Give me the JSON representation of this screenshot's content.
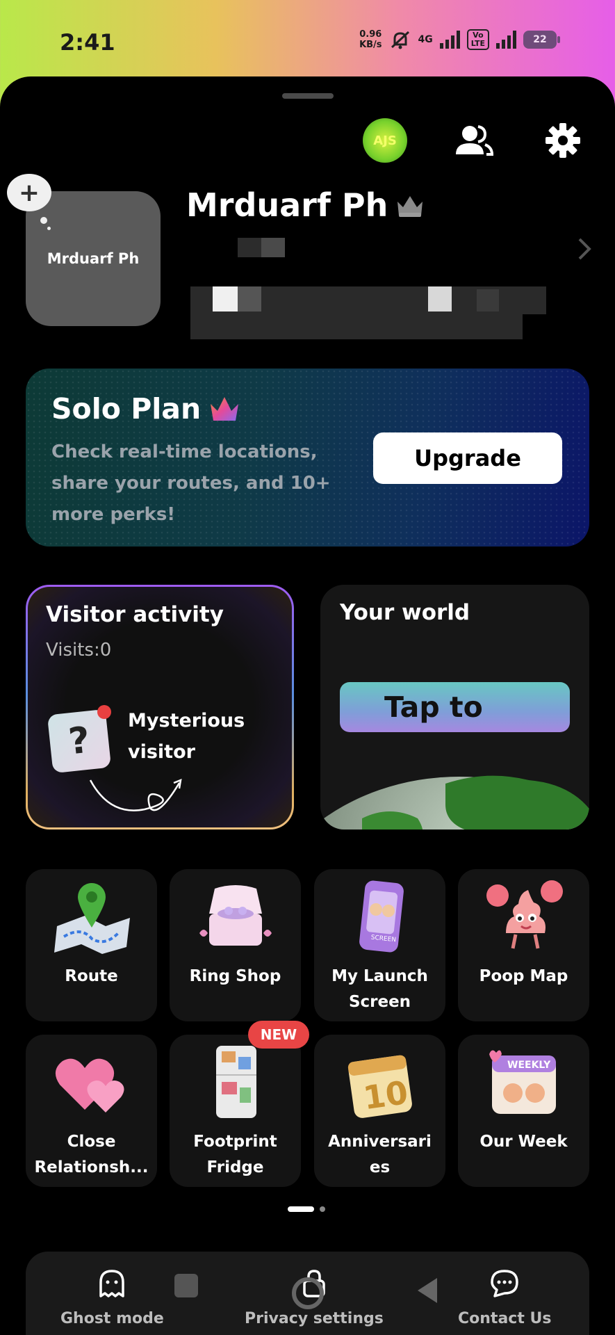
{
  "status_bar": {
    "time": "2:41",
    "net_speed_value": "0.96",
    "net_speed_unit": "KB/s",
    "network_type": "4G",
    "volte_label": "VoLTE",
    "battery_level": "22"
  },
  "header": {
    "badge_text": "AJS"
  },
  "profile": {
    "avatar_text": "Mrduarf Ph",
    "name": "Mrduarf Ph"
  },
  "solo_plan": {
    "title": "Solo Plan",
    "description": "Check real-time locations, share your routes, and 10+ more perks!",
    "upgrade_label": "Upgrade"
  },
  "visitor_activity": {
    "title": "Visitor activity",
    "visits_text": "Visits:0",
    "mystery_label": "Mysterious visitor"
  },
  "your_world": {
    "title": "Your world",
    "tap_label": "Tap to"
  },
  "tiles": [
    {
      "label": "Route",
      "icon": "route-map-icon"
    },
    {
      "label": "Ring Shop",
      "icon": "ring-box-icon"
    },
    {
      "label": "My Launch Screen",
      "icon": "phone-screen-icon"
    },
    {
      "label": "Poop Map",
      "icon": "poop-mascot-icon"
    },
    {
      "label": "Close Relationsh...",
      "icon": "hearts-icon"
    },
    {
      "label": "Footprint Fridge",
      "icon": "fridge-icon",
      "badge": "NEW"
    },
    {
      "label": "Anniversaries",
      "icon": "calendar-10-icon"
    },
    {
      "label": "Our Week",
      "icon": "weekly-calendar-icon"
    }
  ],
  "tile_labels_display": {
    "launch_line1": "My Launch",
    "launch_line2": "Screen",
    "close_line1": "Close",
    "close_line2": "Relationsh...",
    "fridge_line1": "Footprint",
    "fridge_line2": "Fridge",
    "anniv_line1": "Anniversari",
    "anniv_line2": "es"
  },
  "new_badge_text": "NEW",
  "pager": {
    "current": 1,
    "total": 2
  },
  "bottom_bar": {
    "ghost_mode": "Ghost mode",
    "privacy_settings": "Privacy settings",
    "contact_us": "Contact Us"
  },
  "colors": {
    "accent_upgrade": "#ffffff",
    "new_badge": "#e84545",
    "background": "#000000"
  }
}
